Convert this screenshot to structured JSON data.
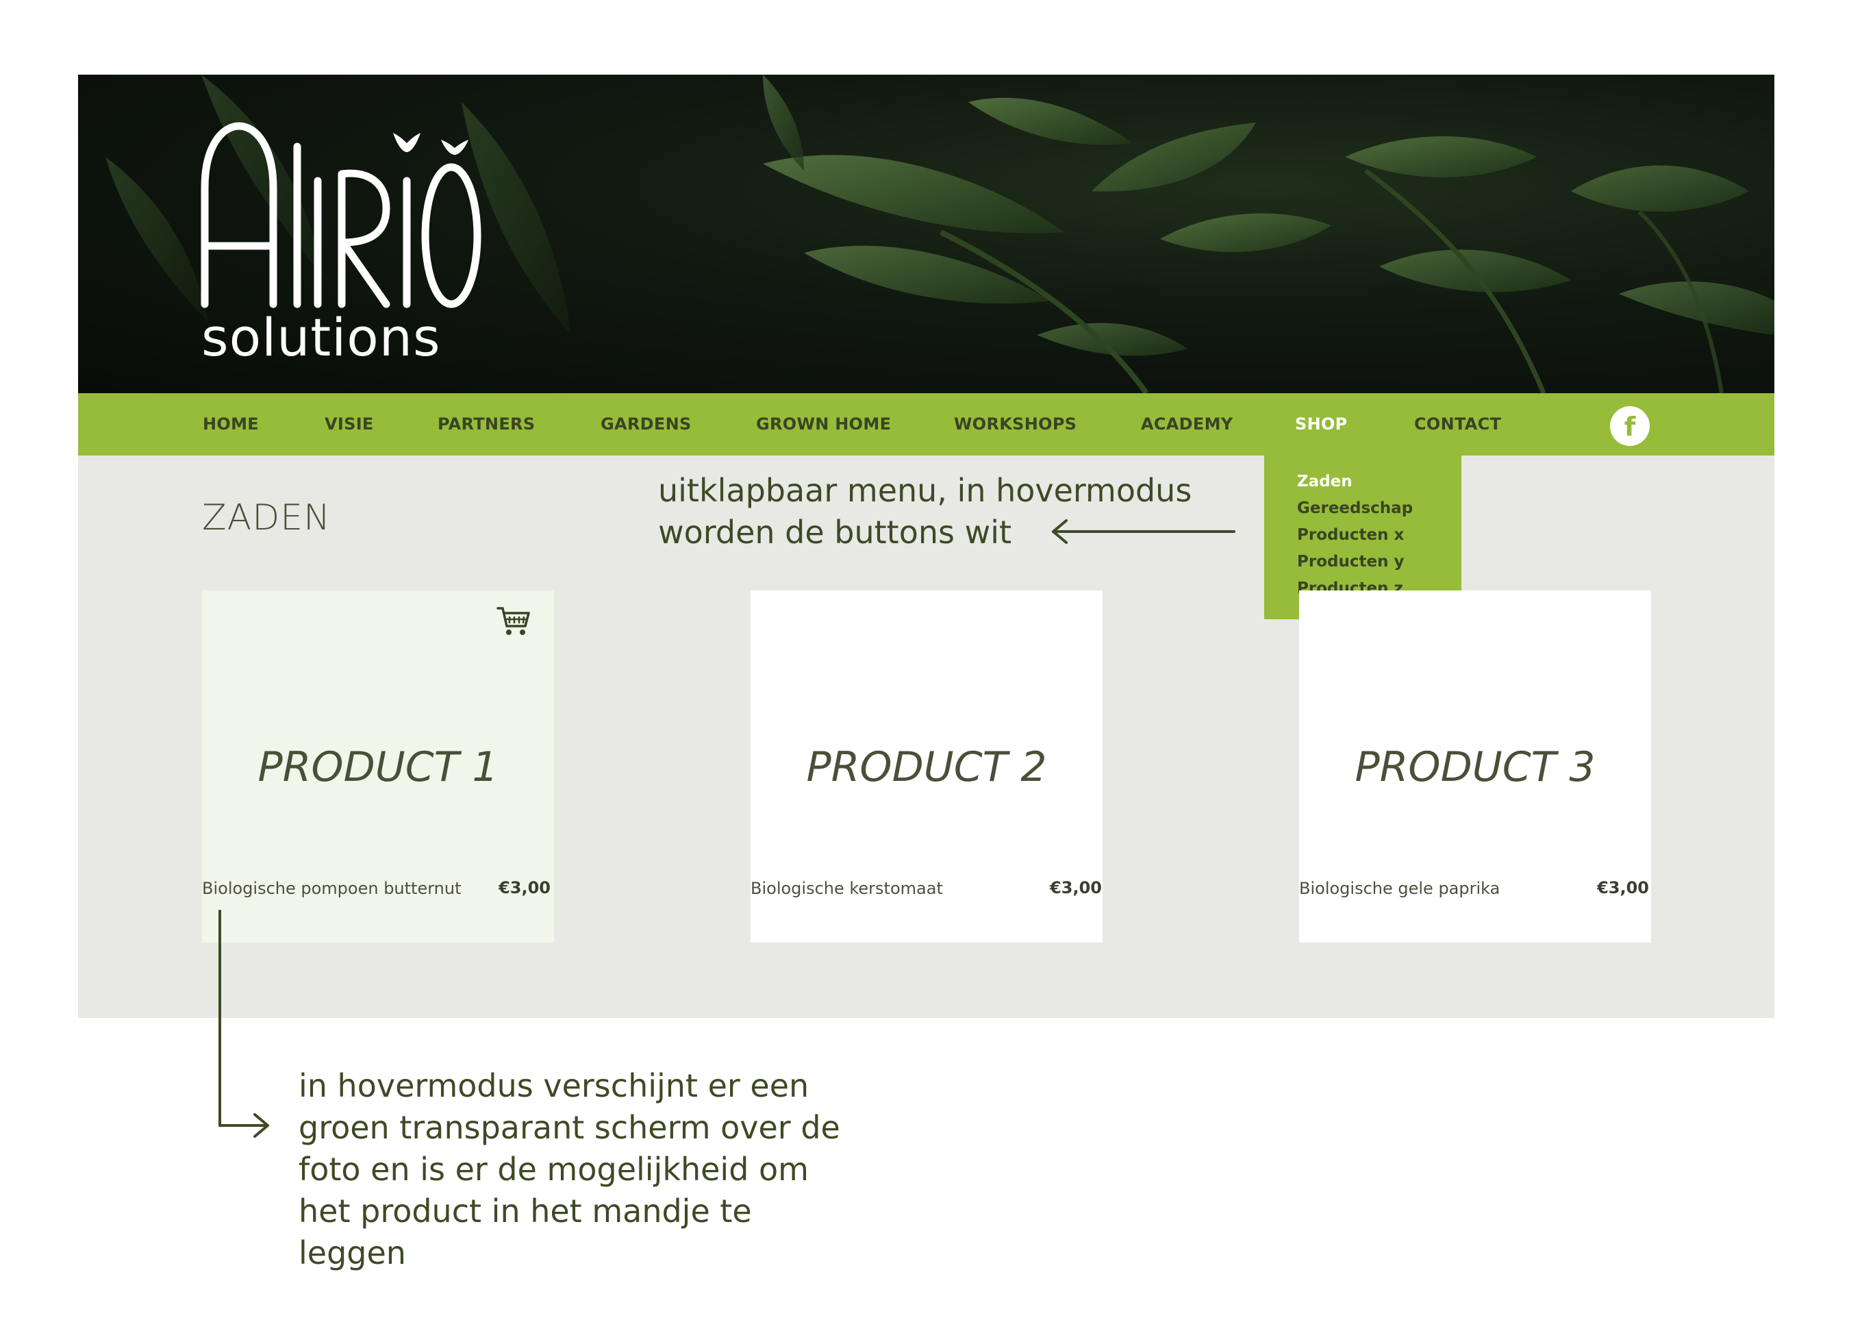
{
  "brand": {
    "logo_line1": "ALIRIO",
    "logo_line2": "solutions"
  },
  "nav": {
    "items": [
      {
        "label": "HOME"
      },
      {
        "label": "VISIE"
      },
      {
        "label": "PARTNERS"
      },
      {
        "label": "GARDENS"
      },
      {
        "label": "GROWN HOME"
      },
      {
        "label": "WORKSHOPS"
      },
      {
        "label": "ACADEMY"
      },
      {
        "label": "SHOP",
        "active": true
      },
      {
        "label": "CONTACT"
      }
    ],
    "social_icon": "facebook-icon",
    "social_glyph": "f"
  },
  "dropdown": {
    "items": [
      {
        "label": "Zaden",
        "active": true
      },
      {
        "label": "Gereedschap"
      },
      {
        "label": "Producten x"
      },
      {
        "label": "Producten y"
      },
      {
        "label": "Producten z"
      }
    ]
  },
  "page": {
    "title": "ZADEN"
  },
  "products": [
    {
      "label": "PRODUCT 1",
      "name": "Biologische pompoen butternut",
      "price": "€3,00",
      "hover": true,
      "cart_icon": "shopping-cart-icon"
    },
    {
      "label": "PRODUCT 2",
      "name": "Biologische kerstomaat",
      "price": "€3,00"
    },
    {
      "label": "PRODUCT 3",
      "name": "Biologische gele paprika",
      "price": "€3,00"
    }
  ],
  "annotations": {
    "menu": [
      "uitklapbaar menu, in hovermodus",
      "worden de buttons wit"
    ],
    "hover": [
      "in hovermodus verschijnt er een",
      "groen transparant scherm over de",
      "foto en is er de mogelijkheid om",
      "het product in het mandje te",
      "leggen"
    ]
  },
  "colors": {
    "nav_green": "#96bc3a",
    "page_bg": "#e8e9e4",
    "hover_tint": "#f2f6ea",
    "text_dark": "#3a4424"
  }
}
